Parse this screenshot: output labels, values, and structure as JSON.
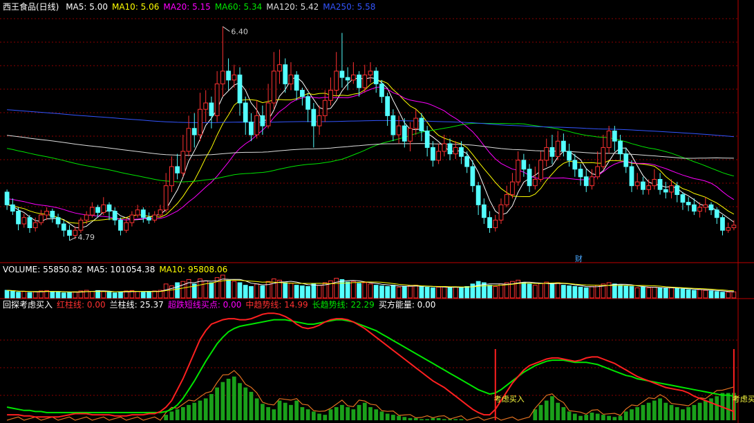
{
  "price_legend": {
    "title": "西王食品(日线)",
    "ma": [
      {
        "label": "MA5: 5.00",
        "color": "#ffffff"
      },
      {
        "label": "MA10: 5.06",
        "color": "#ffff00"
      },
      {
        "label": "MA20: 5.15",
        "color": "#ff00ff"
      },
      {
        "label": "MA60: 5.34",
        "color": "#00e600"
      },
      {
        "label": "MA120: 5.42",
        "color": "#dddddd"
      },
      {
        "label": "MA250: 5.58",
        "color": "#3355ff"
      }
    ]
  },
  "volume_legend": {
    "items": [
      {
        "label": "VOLUME: 55850.82",
        "color": "#ffffff"
      },
      {
        "label": "MA5: 101054.38",
        "color": "#ffffff"
      },
      {
        "label": "MA10: 95808.06",
        "color": "#ffff00"
      }
    ]
  },
  "indicator_legend": {
    "items": [
      {
        "label": "回探考虑买入",
        "color": "#ffffff"
      },
      {
        "label": "红柱线: 0.00",
        "color": "#ff3030"
      },
      {
        "label": "兰柱线: 25.37",
        "color": "#ffffff"
      },
      {
        "label": "超跌短线买点: 0.00",
        "color": "#ff00ff"
      },
      {
        "label": "中趋势线: 14.99",
        "color": "#ff3030"
      },
      {
        "label": "长趋势线: 22.29",
        "color": "#00e600"
      },
      {
        "label": "买方能量: 0.00",
        "color": "#ffffff"
      }
    ]
  },
  "annotations": {
    "high": "6.40",
    "low": "4.79",
    "fin_marker": "财",
    "buy_signal_1": "考虑买入",
    "buy_signal_2": "考虑买"
  },
  "colors": {
    "up": "#ff3232",
    "down": "#54ffff",
    "grid": "#8b0000",
    "border": "#c00000"
  },
  "chart_data": {
    "type": "candlestick",
    "price_range": [
      4.6,
      6.5
    ],
    "candles": [
      [
        5.1,
        5.0,
        5.12,
        4.96
      ],
      [
        5.0,
        4.95,
        5.05,
        4.92
      ],
      [
        4.95,
        4.85,
        4.98,
        4.8
      ],
      [
        4.85,
        4.9,
        4.93,
        4.82
      ],
      [
        4.9,
        4.82,
        4.92,
        4.78
      ],
      [
        4.82,
        4.86,
        4.9,
        4.79
      ],
      [
        4.86,
        4.92,
        4.96,
        4.84
      ],
      [
        4.92,
        4.95,
        4.98,
        4.88
      ],
      [
        4.95,
        4.9,
        4.97,
        4.86
      ],
      [
        4.9,
        4.85,
        4.93,
        4.82
      ],
      [
        4.85,
        4.8,
        4.88,
        4.75
      ],
      [
        4.8,
        4.76,
        4.84,
        4.72
      ],
      [
        4.76,
        4.8,
        4.83,
        4.73
      ],
      [
        4.8,
        4.88,
        4.9,
        4.78
      ],
      [
        4.88,
        4.92,
        4.95,
        4.85
      ],
      [
        4.92,
        4.98,
        5.02,
        4.9
      ],
      [
        4.98,
        4.94,
        5.0,
        4.9
      ],
      [
        4.94,
        5.0,
        5.06,
        4.92
      ],
      [
        5.0,
        4.95,
        5.02,
        4.88
      ],
      [
        4.95,
        4.88,
        4.98,
        4.84
      ],
      [
        4.88,
        4.8,
        4.9,
        4.76
      ],
      [
        4.8,
        4.86,
        4.9,
        4.78
      ],
      [
        4.86,
        4.92,
        4.95,
        4.83
      ],
      [
        4.92,
        4.96,
        5.0,
        4.9
      ],
      [
        4.96,
        4.9,
        4.98,
        4.86
      ],
      [
        4.9,
        4.88,
        4.94,
        4.85
      ],
      [
        4.88,
        4.92,
        4.95,
        4.86
      ],
      [
        4.92,
        4.96,
        5.0,
        4.9
      ],
      [
        4.96,
        5.15,
        5.25,
        4.94
      ],
      [
        5.15,
        5.3,
        5.38,
        5.1
      ],
      [
        5.3,
        5.25,
        5.4,
        5.2
      ],
      [
        5.25,
        5.42,
        5.55,
        5.22
      ],
      [
        5.42,
        5.6,
        5.7,
        5.38
      ],
      [
        5.6,
        5.55,
        5.72,
        5.45
      ],
      [
        5.55,
        5.75,
        5.88,
        5.5
      ],
      [
        5.75,
        5.8,
        5.9,
        5.65
      ],
      [
        5.8,
        5.7,
        5.85,
        5.6
      ],
      [
        5.7,
        5.95,
        6.05,
        5.65
      ],
      [
        5.95,
        6.05,
        6.4,
        5.85
      ],
      [
        6.05,
        5.98,
        6.15,
        5.9
      ],
      [
        5.98,
        6.02,
        6.1,
        5.92
      ],
      [
        6.02,
        5.8,
        6.08,
        5.7
      ],
      [
        5.8,
        5.65,
        5.85,
        5.55
      ],
      [
        5.65,
        5.55,
        5.72,
        5.5
      ],
      [
        5.55,
        5.7,
        5.82,
        5.52
      ],
      [
        5.7,
        5.62,
        5.78,
        5.55
      ],
      [
        5.62,
        5.8,
        5.95,
        5.6
      ],
      [
        5.8,
        6.05,
        6.2,
        5.75
      ],
      [
        6.05,
        6.1,
        6.22,
        5.95
      ],
      [
        6.1,
        5.95,
        6.15,
        5.88
      ],
      [
        5.95,
        6.02,
        6.12,
        5.9
      ],
      [
        6.02,
        5.9,
        6.05,
        5.82
      ],
      [
        5.9,
        5.85,
        5.92,
        5.78
      ],
      [
        5.85,
        5.75,
        5.88,
        5.65
      ],
      [
        5.75,
        5.62,
        5.8,
        5.45
      ],
      [
        5.62,
        5.7,
        5.78,
        5.55
      ],
      [
        5.7,
        5.82,
        5.9,
        5.65
      ],
      [
        5.82,
        5.9,
        6.0,
        5.78
      ],
      [
        5.9,
        6.05,
        6.2,
        5.85
      ],
      [
        6.05,
        6.0,
        6.35,
        5.92
      ],
      [
        6.0,
        5.98,
        6.08,
        5.9
      ],
      [
        5.98,
        6.02,
        6.12,
        5.95
      ],
      [
        6.02,
        5.92,
        6.05,
        5.85
      ],
      [
        5.92,
        6.02,
        6.1,
        5.88
      ],
      [
        6.02,
        6.05,
        6.12,
        5.96
      ],
      [
        6.05,
        5.95,
        6.08,
        5.88
      ],
      [
        5.95,
        5.85,
        5.98,
        5.8
      ],
      [
        5.85,
        5.7,
        5.88,
        5.62
      ],
      [
        5.7,
        5.55,
        5.75,
        5.5
      ],
      [
        5.55,
        5.62,
        5.7,
        5.48
      ],
      [
        5.62,
        5.5,
        5.68,
        5.45
      ],
      [
        5.5,
        5.6,
        5.65,
        5.42
      ],
      [
        5.6,
        5.68,
        5.75,
        5.55
      ],
      [
        5.68,
        5.58,
        5.72,
        5.5
      ],
      [
        5.58,
        5.45,
        5.62,
        5.38
      ],
      [
        5.45,
        5.35,
        5.5,
        5.3
      ],
      [
        5.35,
        5.42,
        5.48,
        5.32
      ],
      [
        5.42,
        5.48,
        5.55,
        5.38
      ],
      [
        5.48,
        5.4,
        5.52,
        5.35
      ],
      [
        5.4,
        5.45,
        5.5,
        5.36
      ],
      [
        5.45,
        5.38,
        5.5,
        5.32
      ],
      [
        5.38,
        5.3,
        5.42,
        5.25
      ],
      [
        5.3,
        5.15,
        5.35,
        5.1
      ],
      [
        5.15,
        5.0,
        5.18,
        4.92
      ],
      [
        5.0,
        4.9,
        5.05,
        4.85
      ],
      [
        4.9,
        4.82,
        4.95,
        4.78
      ],
      [
        4.82,
        4.88,
        4.92,
        4.79
      ],
      [
        4.88,
        5.0,
        5.05,
        4.85
      ],
      [
        5.0,
        5.08,
        5.15,
        4.98
      ],
      [
        5.08,
        5.18,
        5.25,
        5.05
      ],
      [
        5.18,
        5.35,
        5.42,
        5.15
      ],
      [
        5.35,
        5.28,
        5.4,
        5.22
      ],
      [
        5.28,
        5.15,
        5.32,
        5.1
      ],
      [
        5.15,
        5.2,
        5.3,
        5.12
      ],
      [
        5.2,
        5.35,
        5.42,
        5.18
      ],
      [
        5.35,
        5.45,
        5.52,
        5.3
      ],
      [
        5.45,
        5.38,
        5.55,
        5.32
      ],
      [
        5.38,
        5.5,
        5.58,
        5.35
      ],
      [
        5.5,
        5.42,
        5.56,
        5.38
      ],
      [
        5.42,
        5.35,
        5.48,
        5.3
      ],
      [
        5.35,
        5.28,
        5.4,
        5.22
      ],
      [
        5.28,
        5.22,
        5.32,
        5.15
      ],
      [
        5.22,
        5.15,
        5.28,
        5.1
      ],
      [
        5.15,
        5.22,
        5.28,
        5.12
      ],
      [
        5.22,
        5.3,
        5.42,
        5.2
      ],
      [
        5.3,
        5.45,
        5.55,
        5.28
      ],
      [
        5.45,
        5.58,
        5.62,
        5.4
      ],
      [
        5.58,
        5.5,
        5.62,
        5.42
      ],
      [
        5.5,
        5.4,
        5.55,
        5.35
      ],
      [
        5.4,
        5.3,
        5.45,
        5.25
      ],
      [
        5.3,
        5.15,
        5.35,
        5.1
      ],
      [
        5.15,
        5.18,
        5.25,
        5.12
      ],
      [
        5.18,
        5.12,
        5.22,
        5.08
      ],
      [
        5.12,
        5.15,
        5.2,
        5.08
      ],
      [
        5.15,
        5.2,
        5.28,
        5.12
      ],
      [
        5.2,
        5.12,
        5.25,
        5.08
      ],
      [
        5.12,
        5.1,
        5.18,
        5.05
      ],
      [
        5.1,
        5.15,
        5.2,
        5.05
      ],
      [
        5.15,
        5.08,
        5.18,
        5.02
      ],
      [
        5.08,
        5.02,
        5.1,
        4.96
      ],
      [
        5.02,
        5.0,
        5.06,
        4.95
      ],
      [
        5.0,
        4.95,
        5.05,
        4.92
      ],
      [
        4.95,
        4.98,
        5.02,
        4.9
      ],
      [
        4.98,
        5.0,
        5.06,
        4.94
      ],
      [
        5.0,
        4.96,
        5.02,
        4.92
      ],
      [
        4.96,
        4.9,
        4.98,
        4.85
      ],
      [
        4.9,
        4.8,
        4.92,
        4.76
      ],
      [
        4.8,
        4.82,
        4.86,
        4.78
      ],
      [
        4.82,
        4.84,
        4.88,
        4.8
      ]
    ],
    "volume_max": 300000,
    "volume_series": [
      60,
      55,
      45,
      50,
      42,
      48,
      55,
      58,
      50,
      45,
      40,
      42,
      48,
      55,
      60,
      52,
      58,
      50,
      45,
      40,
      48,
      55,
      58,
      50,
      45,
      50,
      55,
      60,
      110,
      95,
      120,
      130,
      145,
      110,
      150,
      135,
      120,
      160,
      180,
      140,
      130,
      120,
      100,
      90,
      110,
      95,
      130,
      150,
      140,
      120,
      115,
      100,
      95,
      90,
      110,
      100,
      120,
      135,
      155,
      145,
      125,
      130,
      115,
      120,
      110,
      100,
      95,
      90,
      100,
      85,
      90,
      95,
      100,
      90,
      85,
      80,
      85,
      90,
      80,
      85,
      80,
      90,
      110,
      130,
      120,
      100,
      90,
      110,
      120,
      130,
      140,
      120,
      110,
      100,
      115,
      125,
      110,
      120,
      100,
      95,
      90,
      85,
      80,
      90,
      100,
      110,
      120,
      110,
      100,
      95,
      90,
      80,
      85,
      80,
      85,
      80,
      75,
      80,
      75,
      70,
      65,
      60,
      65,
      60,
      55,
      50,
      45,
      45,
      48
    ],
    "indicator_range": [
      0,
      100
    ],
    "mid_trend": [
      5,
      5,
      5,
      4,
      4,
      3,
      3,
      3,
      3,
      3,
      4,
      5,
      6,
      6,
      6,
      5,
      5,
      5,
      5,
      4,
      4,
      4,
      5,
      5,
      5,
      6,
      6,
      8,
      12,
      18,
      28,
      38,
      50,
      62,
      74,
      82,
      88,
      90,
      92,
      93,
      93,
      92,
      92,
      93,
      95,
      97,
      98,
      98,
      97,
      95,
      92,
      88,
      85,
      84,
      85,
      87,
      90,
      92,
      93,
      93,
      92,
      90,
      87,
      84,
      80,
      76,
      72,
      68,
      64,
      60,
      56,
      52,
      48,
      44,
      40,
      36,
      33,
      30,
      26,
      22,
      18,
      14,
      10,
      7,
      5,
      5,
      10,
      18,
      26,
      34,
      40,
      46,
      50,
      52,
      54,
      56,
      57,
      57,
      56,
      55,
      54,
      55,
      57,
      58,
      58,
      56,
      54,
      52,
      49,
      46,
      43,
      40,
      38,
      36,
      34,
      32,
      30,
      29,
      28,
      27,
      25,
      22,
      20,
      18,
      16,
      14,
      12,
      10,
      8
    ],
    "long_trend": [
      12,
      11,
      10,
      9,
      9,
      8,
      8,
      7,
      7,
      7,
      7,
      7,
      7,
      7,
      7,
      7,
      7,
      7,
      7,
      7,
      7,
      7,
      7,
      7,
      7,
      7,
      7,
      7,
      8,
      10,
      14,
      20,
      28,
      36,
      45,
      54,
      62,
      70,
      76,
      81,
      84,
      86,
      87,
      88,
      89,
      90,
      91,
      92,
      92,
      92,
      91,
      90,
      89,
      88,
      88,
      89,
      90,
      91,
      92,
      92,
      91,
      90,
      88,
      86,
      84,
      82,
      79,
      76,
      73,
      70,
      67,
      64,
      61,
      58,
      55,
      52,
      49,
      46,
      43,
      40,
      37,
      34,
      31,
      28,
      26,
      24,
      25,
      28,
      32,
      36,
      40,
      44,
      47,
      50,
      52,
      54,
      55,
      55,
      55,
      54,
      53,
      53,
      53,
      52,
      51,
      49,
      47,
      45,
      43,
      41,
      40,
      38,
      37,
      36,
      35,
      34,
      33,
      32,
      31,
      30,
      29,
      28,
      27,
      26,
      25,
      24,
      23,
      23,
      22
    ],
    "blue_bars": [
      0,
      0,
      0,
      0,
      0,
      0,
      0,
      0,
      0,
      0,
      0,
      0,
      0,
      0,
      0,
      0,
      0,
      0,
      0,
      0,
      0,
      0,
      0,
      0,
      0,
      0,
      0,
      0,
      5,
      8,
      10,
      12,
      14,
      16,
      18,
      20,
      24,
      30,
      35,
      38,
      40,
      34,
      30,
      26,
      20,
      15,
      12,
      10,
      18,
      16,
      14,
      18,
      12,
      10,
      8,
      6,
      5,
      10,
      12,
      14,
      12,
      10,
      14,
      16,
      12,
      10,
      8,
      6,
      5,
      4,
      3,
      2,
      2,
      1,
      1,
      2,
      2,
      1,
      1,
      1,
      1,
      0,
      0,
      0,
      0,
      0,
      0,
      0,
      0,
      0,
      0,
      0,
      0,
      10,
      14,
      18,
      22,
      16,
      12,
      8,
      6,
      4,
      5,
      7,
      6,
      5,
      4,
      3,
      4,
      8,
      10,
      12,
      14,
      16,
      18,
      20,
      16,
      14,
      12,
      10,
      12,
      14,
      16,
      18,
      20,
      22,
      25,
      25,
      25
    ],
    "buy_signal_index": [
      86,
      128
    ],
    "buy_signal_labels": [
      "考虑买入",
      "考虑买"
    ]
  }
}
